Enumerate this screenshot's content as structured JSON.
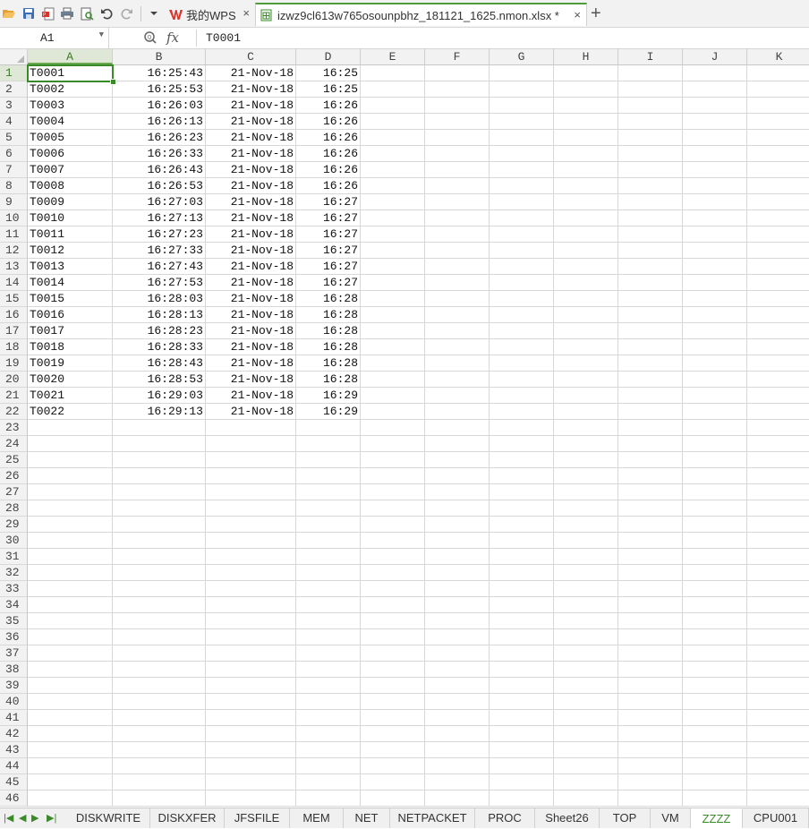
{
  "titlebar": {
    "home_tab": "我的WPS",
    "file_tab": "izwz9cl613w765osounpbhz_181121_1625.nmon.xlsx *",
    "close_glyph": "×",
    "add_glyph": "+"
  },
  "formula_bar": {
    "cell_ref": "A1",
    "fx_label": "fx",
    "content": "T0001"
  },
  "columns": [
    "A",
    "B",
    "C",
    "D",
    "E",
    "F",
    "G",
    "H",
    "I",
    "J",
    "K"
  ],
  "row_numbers": [
    "1",
    "2",
    "3",
    "4",
    "5",
    "6",
    "7",
    "8",
    "9",
    "10",
    "11",
    "12",
    "13",
    "14",
    "15",
    "16",
    "17",
    "18",
    "19",
    "20",
    "21",
    "22",
    "23",
    "24",
    "25",
    "26",
    "27",
    "28",
    "29",
    "30",
    "31",
    "32",
    "33",
    "34",
    "35",
    "36",
    "37",
    "38",
    "39",
    "40",
    "41",
    "42",
    "43",
    "44",
    "45",
    "46"
  ],
  "rows": [
    [
      "T0001",
      "16:25:43",
      "21-Nov-18",
      "16:25"
    ],
    [
      "T0002",
      "16:25:53",
      "21-Nov-18",
      "16:25"
    ],
    [
      "T0003",
      "16:26:03",
      "21-Nov-18",
      "16:26"
    ],
    [
      "T0004",
      "16:26:13",
      "21-Nov-18",
      "16:26"
    ],
    [
      "T0005",
      "16:26:23",
      "21-Nov-18",
      "16:26"
    ],
    [
      "T0006",
      "16:26:33",
      "21-Nov-18",
      "16:26"
    ],
    [
      "T0007",
      "16:26:43",
      "21-Nov-18",
      "16:26"
    ],
    [
      "T0008",
      "16:26:53",
      "21-Nov-18",
      "16:26"
    ],
    [
      "T0009",
      "16:27:03",
      "21-Nov-18",
      "16:27"
    ],
    [
      "T0010",
      "16:27:13",
      "21-Nov-18",
      "16:27"
    ],
    [
      "T0011",
      "16:27:23",
      "21-Nov-18",
      "16:27"
    ],
    [
      "T0012",
      "16:27:33",
      "21-Nov-18",
      "16:27"
    ],
    [
      "T0013",
      "16:27:43",
      "21-Nov-18",
      "16:27"
    ],
    [
      "T0014",
      "16:27:53",
      "21-Nov-18",
      "16:27"
    ],
    [
      "T0015",
      "16:28:03",
      "21-Nov-18",
      "16:28"
    ],
    [
      "T0016",
      "16:28:13",
      "21-Nov-18",
      "16:28"
    ],
    [
      "T0017",
      "16:28:23",
      "21-Nov-18",
      "16:28"
    ],
    [
      "T0018",
      "16:28:33",
      "21-Nov-18",
      "16:28"
    ],
    [
      "T0019",
      "16:28:43",
      "21-Nov-18",
      "16:28"
    ],
    [
      "T0020",
      "16:28:53",
      "21-Nov-18",
      "16:28"
    ],
    [
      "T0021",
      "16:29:03",
      "21-Nov-18",
      "16:29"
    ],
    [
      "T0022",
      "16:29:13",
      "21-Nov-18",
      "16:29"
    ]
  ],
  "sheet_tabs": [
    "DISKWRITE",
    "DISKXFER",
    "JFSFILE",
    "MEM",
    "NET",
    "NETPACKET",
    "PROC",
    "Sheet26",
    "TOP",
    "VM",
    "ZZZZ",
    "CPU001"
  ],
  "active_sheet": "ZZZZ",
  "colors": {
    "accent": "#3a8a2a",
    "selected_header": "#dfe8d6"
  }
}
